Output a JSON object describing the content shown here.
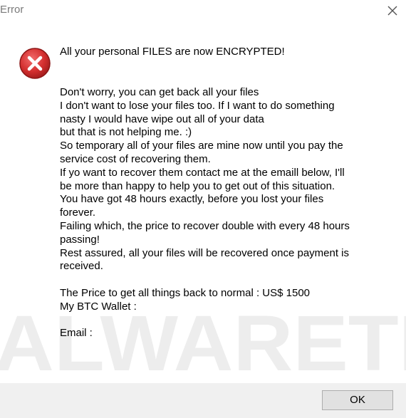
{
  "window": {
    "title": "Error",
    "close_icon": "close-icon",
    "watermark_text": "ALWARETI"
  },
  "dialog": {
    "icon": "error-icon",
    "heading": "All your personal FILES are now ENCRYPTED!",
    "lines": [
      "Don't worry, you can get back all your files",
      "I don't want to lose your files too. If I want to do something",
      "nasty I would have wipe out all of your data",
      "but that is not helping me. :)",
      "So temporary all of your files are mine now until you pay the",
      "service cost of recovering them.",
      "If yo want to recover them contact me at the emaill below, I'll",
      "be more than happy to help you to get out of this situation.",
      "You have got 48 hours exactly, before you lost your files",
      "forever.",
      "Failing which, the price to recover double with every 48 hours",
      "passing!",
      "Rest assured, all your files will be recovered once payment is",
      "received.",
      "",
      "The Price to get all things back to normal : US$ 1500",
      "My BTC Wallet :",
      "",
      "Email :"
    ]
  },
  "footer": {
    "ok_label": "OK"
  },
  "colors": {
    "footer_bg": "#f0f0f0",
    "error_red": "#d32f2f"
  }
}
